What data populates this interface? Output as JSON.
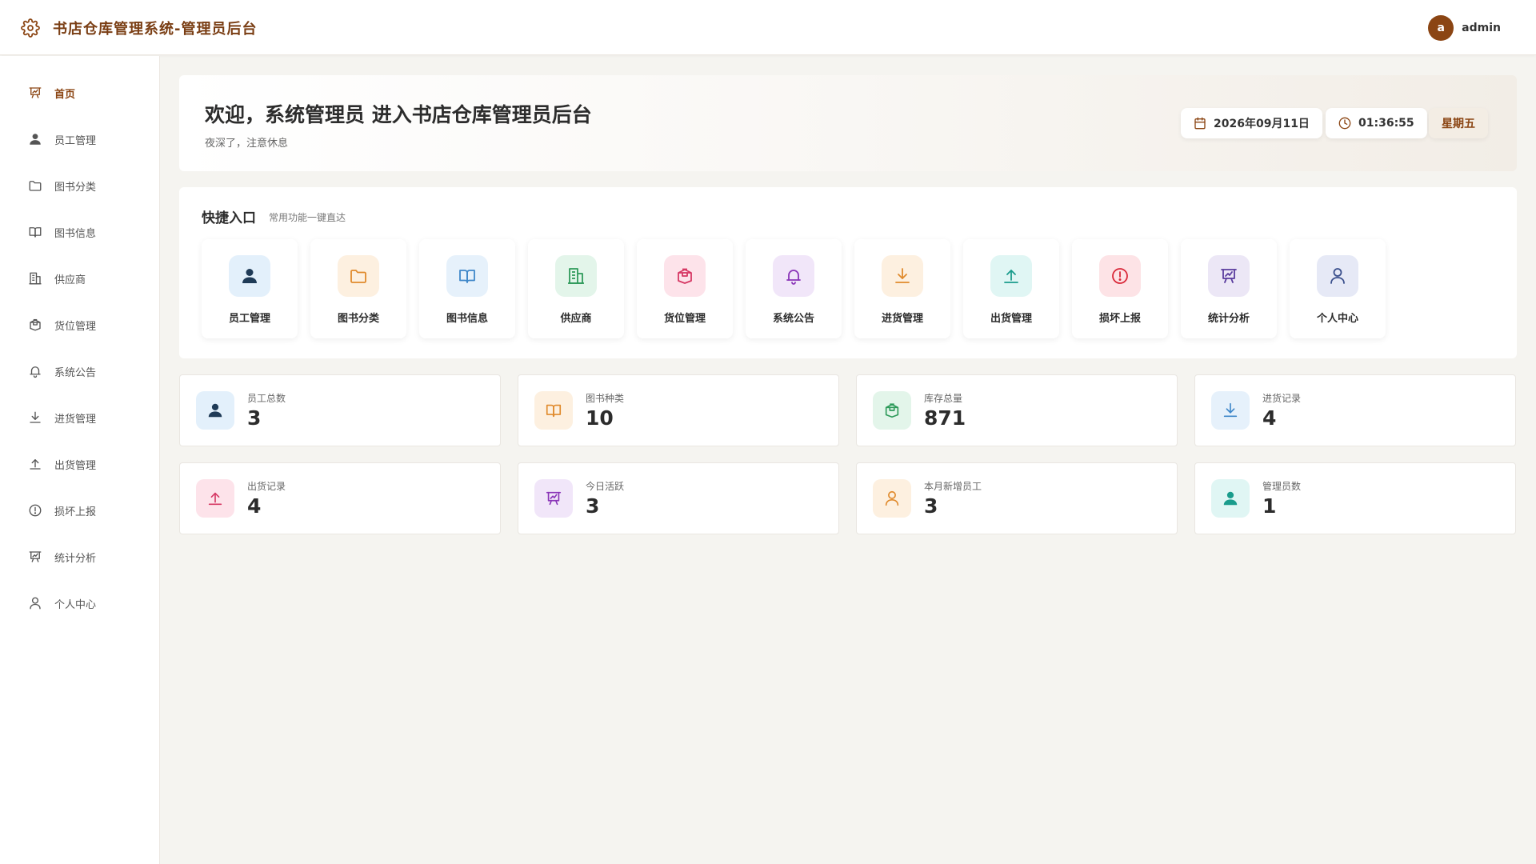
{
  "header": {
    "title": "书店仓库管理系统-管理员后台",
    "avatar_letter": "a",
    "username": "admin"
  },
  "sidebar": {
    "items": [
      {
        "label": "首页",
        "icon": "presentation-chart-icon",
        "active": true
      },
      {
        "label": "员工管理",
        "icon": "user-filled-icon"
      },
      {
        "label": "图书分类",
        "icon": "folder-icon"
      },
      {
        "label": "图书信息",
        "icon": "book-open-icon"
      },
      {
        "label": "供应商",
        "icon": "building-icon"
      },
      {
        "label": "货位管理",
        "icon": "box-icon"
      },
      {
        "label": "系统公告",
        "icon": "bell-icon"
      },
      {
        "label": "进货管理",
        "icon": "download-icon"
      },
      {
        "label": "出货管理",
        "icon": "upload-icon"
      },
      {
        "label": "损坏上报",
        "icon": "warning-circle-icon"
      },
      {
        "label": "统计分析",
        "icon": "presentation-chart-icon"
      },
      {
        "label": "个人中心",
        "icon": "user-outline-icon"
      }
    ]
  },
  "welcome": {
    "title": "欢迎，系统管理员 进入书店仓库管理员后台",
    "subtitle": "夜深了，注意休息",
    "date": "2026年09月11日",
    "time": "01:36:55",
    "weekday": "星期五"
  },
  "quick": {
    "title": "快捷入口",
    "subtitle": "常用功能一键直达",
    "items": [
      {
        "label": "员工管理",
        "icon": "user-filled-icon",
        "bg": "#e3f0fb",
        "color": "#1f3b57"
      },
      {
        "label": "图书分类",
        "icon": "folder-icon",
        "bg": "#fdf0e0",
        "color": "#e08a2c"
      },
      {
        "label": "图书信息",
        "icon": "book-open-icon",
        "bg": "#e6f1fb",
        "color": "#3f87c9"
      },
      {
        "label": "供应商",
        "icon": "building-icon",
        "bg": "#e3f5ea",
        "color": "#2e9a5a"
      },
      {
        "label": "货位管理",
        "icon": "box-icon",
        "bg": "#fde3ea",
        "color": "#d63864"
      },
      {
        "label": "系统公告",
        "icon": "bell-icon",
        "bg": "#f1e6f9",
        "color": "#8a35b8"
      },
      {
        "label": "进货管理",
        "icon": "download-icon",
        "bg": "#fdf0e0",
        "color": "#e08a2c"
      },
      {
        "label": "出货管理",
        "icon": "upload-icon",
        "bg": "#e0f6f4",
        "color": "#1a9c8c"
      },
      {
        "label": "损坏上报",
        "icon": "warning-circle-icon",
        "bg": "#fde3e6",
        "color": "#d9293a"
      },
      {
        "label": "统计分析",
        "icon": "presentation-chart-icon",
        "bg": "#ece7f6",
        "color": "#5a3c9e"
      },
      {
        "label": "个人中心",
        "icon": "user-outline-icon",
        "bg": "#e6e9f6",
        "color": "#3a4f8c"
      }
    ]
  },
  "stats": [
    {
      "label": "员工总数",
      "value": "3",
      "icon": "user-filled-icon",
      "bg": "#e3f0fb",
      "color": "#1f3b57"
    },
    {
      "label": "图书种类",
      "value": "10",
      "icon": "book-open-icon",
      "bg": "#fdf0e0",
      "color": "#e08a2c"
    },
    {
      "label": "库存总量",
      "value": "871",
      "icon": "box-icon",
      "bg": "#e3f5ea",
      "color": "#2e9a5a"
    },
    {
      "label": "进货记录",
      "value": "4",
      "icon": "download-icon",
      "bg": "#e6f1fb",
      "color": "#3f87c9"
    },
    {
      "label": "出货记录",
      "value": "4",
      "icon": "upload-icon",
      "bg": "#fde3ea",
      "color": "#d63864"
    },
    {
      "label": "今日活跃",
      "value": "3",
      "icon": "presentation-chart-icon",
      "bg": "#f1e6f9",
      "color": "#8a35b8"
    },
    {
      "label": "本月新增员工",
      "value": "3",
      "icon": "user-outline-icon",
      "bg": "#fdf0e0",
      "color": "#e08a2c"
    },
    {
      "label": "管理员数",
      "value": "1",
      "icon": "user-filled-icon",
      "bg": "#e0f6f4",
      "color": "#1a9c8c"
    }
  ],
  "colors": {
    "brand": "#8b4513",
    "page_bg": "#f5f4f0"
  }
}
